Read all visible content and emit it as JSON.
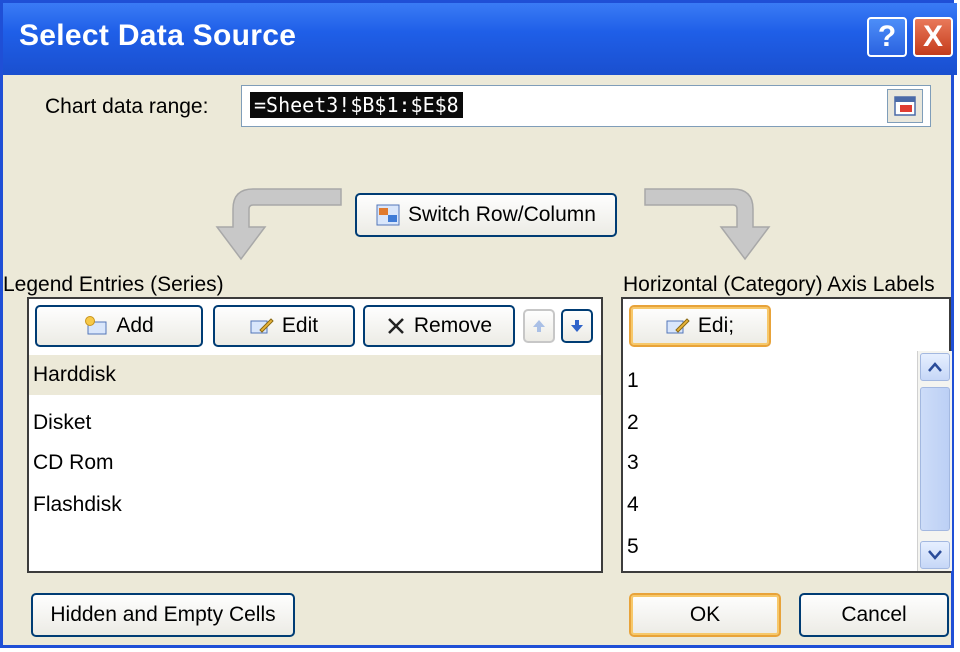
{
  "window": {
    "title": "Select Data Source",
    "help_label": "?",
    "close_label": "X"
  },
  "range": {
    "label": "Chart data range:",
    "value": "=Sheet3!$B$1:$E$8"
  },
  "switch_button_label": "Switch Row/Column",
  "legend": {
    "header": "Legend Entries (Series)",
    "add_label": "Add",
    "edit_label": "Edit",
    "remove_label": "Remove",
    "items": [
      "Harddisk",
      "Disket",
      "CD Rom",
      "Flashdisk"
    ]
  },
  "axis": {
    "header": "Horizontal (Category) Axis Labels",
    "edit_label": "Edi;",
    "items": [
      "1",
      "2",
      "3",
      "4",
      "5"
    ]
  },
  "footer": {
    "hidden_cells_label": "Hidden and Empty Cells",
    "ok_label": "OK",
    "cancel_label": "Cancel"
  },
  "colors": {
    "title_bar": "#1f5fe8",
    "dialog_bg": "#ece9d8",
    "focus_border": "#e8a33a"
  }
}
